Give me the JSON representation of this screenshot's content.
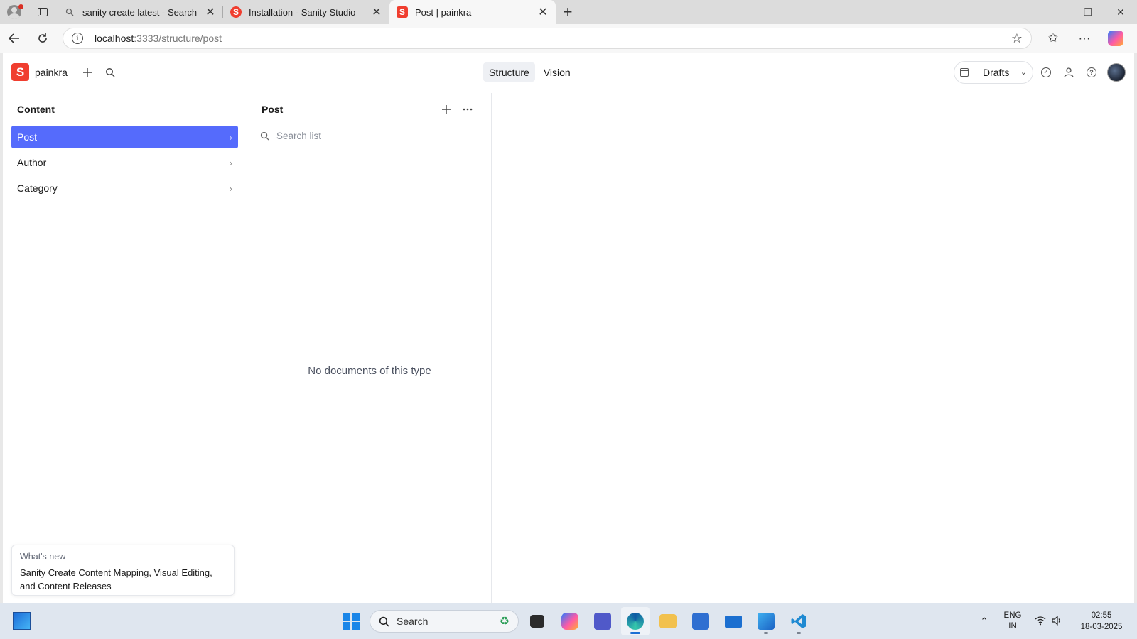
{
  "browser": {
    "tabs": [
      {
        "title": "sanity create latest - Search",
        "favicon": "search-icon",
        "active": false
      },
      {
        "title": "Installation - Sanity Studio",
        "favicon": "sanity-logo-icon",
        "active": false
      },
      {
        "title": "Post | painkra",
        "favicon": "sanity-logo-icon",
        "active": true
      }
    ],
    "url_host": "localhost",
    "url_path": ":3333/structure/post"
  },
  "studio": {
    "project_name": "painkra",
    "logo_letter": "S",
    "tools": [
      {
        "label": "Structure",
        "selected": true
      },
      {
        "label": "Vision",
        "selected": false
      }
    ],
    "release_selector": "Drafts",
    "content_pane": {
      "title": "Content",
      "items": [
        {
          "label": "Post",
          "selected": true
        },
        {
          "label": "Author",
          "selected": false
        },
        {
          "label": "Category",
          "selected": false
        }
      ]
    },
    "list_pane": {
      "title": "Post",
      "search_placeholder": "Search list",
      "empty_message": "No documents of this type"
    },
    "whats_new": {
      "label": "What's new",
      "title": "Sanity Create Content Mapping, Visual Editing, and Content Releases"
    }
  },
  "taskbar": {
    "search_label": "Search",
    "lang_line1": "ENG",
    "lang_line2": "IN",
    "time": "02:55",
    "date": "18-03-2025"
  },
  "colors": {
    "accent": "#556bfc",
    "sanity_red": "#f03e2f"
  }
}
